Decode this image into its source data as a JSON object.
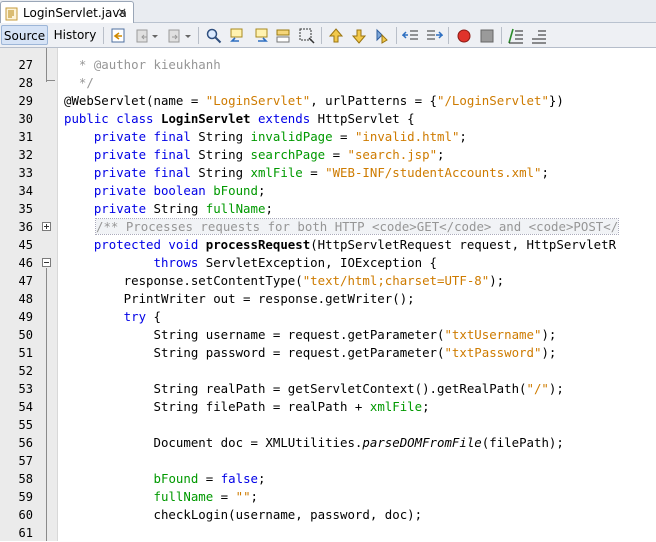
{
  "tab": {
    "title": "LoginServlet.java",
    "close": "×"
  },
  "toolbar": {
    "source_label": "Source",
    "history_label": "History"
  },
  "lines": [
    {
      "n": "27"
    },
    {
      "n": "28"
    },
    {
      "n": "29"
    },
    {
      "n": "30"
    },
    {
      "n": "31"
    },
    {
      "n": "32"
    },
    {
      "n": "33"
    },
    {
      "n": "34"
    },
    {
      "n": "35"
    },
    {
      "n": "36"
    },
    {
      "n": "45"
    },
    {
      "n": "46"
    },
    {
      "n": "47"
    },
    {
      "n": "48"
    },
    {
      "n": "49"
    },
    {
      "n": "50"
    },
    {
      "n": "51"
    },
    {
      "n": "52"
    },
    {
      "n": "53"
    },
    {
      "n": "54"
    },
    {
      "n": "55"
    },
    {
      "n": "56"
    },
    {
      "n": "57"
    },
    {
      "n": "58"
    },
    {
      "n": "59"
    },
    {
      "n": "60"
    },
    {
      "n": "61"
    }
  ],
  "code": {
    "l27": {
      "a": "  * @author kieukhanh"
    },
    "l28": {
      "a": "  */"
    },
    "l29": {
      "a": "@WebServlet(name = ",
      "b": "\"LoginServlet\"",
      "c": ", urlPatterns = {",
      "d": "\"/LoginServlet\"",
      "e": "})"
    },
    "l30": {
      "a": "public class",
      "b": " LoginServlet ",
      "c": "extends",
      "d": " HttpServlet {"
    },
    "l31": {
      "a": "    private final",
      "b": " String ",
      "c": "invalidPage",
      "d": " = ",
      "e": "\"invalid.html\"",
      "f": ";"
    },
    "l32": {
      "a": "    private final",
      "b": " String ",
      "c": "searchPage",
      "d": " = ",
      "e": "\"search.jsp\"",
      "f": ";"
    },
    "l33": {
      "a": "    private final",
      "b": " String ",
      "c": "xmlFile",
      "d": " = ",
      "e": "\"WEB-INF/studentAccounts.xml\"",
      "f": ";"
    },
    "l34": {
      "a": "    private boolean",
      "b": " ",
      "c": "bFound",
      "d": ";"
    },
    "l35": {
      "a": "    private",
      "b": " String ",
      "c": "fullName",
      "d": ";"
    },
    "l36": {
      "a": "/** Processes requests for both HTTP <code>GET</code> and <code>POST</"
    },
    "l45": {
      "a": "    protected void",
      "b": " processRequest",
      "c": "(HttpServletRequest request, HttpServletR"
    },
    "l46": {
      "a": "            throws",
      "b": " ServletException, IOException {"
    },
    "l47": {
      "a": "        response.setContentType(",
      "b": "\"text/html;charset=UTF-8\"",
      "c": ");"
    },
    "l48": {
      "a": "        PrintWriter out = response.getWriter();"
    },
    "l49": {
      "a": "        try",
      "b": " {"
    },
    "l50": {
      "a": "            String username = request.getParameter(",
      "b": "\"txtUsername\"",
      "c": ");"
    },
    "l51": {
      "a": "            String password = request.getParameter(",
      "b": "\"txtPassword\"",
      "c": ");"
    },
    "l53": {
      "a": "            String realPath = getServletContext().getRealPath(",
      "b": "\"/\"",
      "c": ");"
    },
    "l54": {
      "a": "            String filePath = realPath + ",
      "b": "xmlFile",
      "c": ";"
    },
    "l56": {
      "a": "            Document doc = XMLUtilities.",
      "b": "parseDOMFromFile",
      "c": "(filePath);"
    },
    "l58": {
      "a": "            ",
      "b": "bFound",
      "c": " = ",
      "d": "false",
      "e": ";"
    },
    "l59": {
      "a": "            ",
      "b": "fullName",
      "c": " = ",
      "d": "\"\"",
      "e": ";"
    },
    "l60": {
      "a": "            checkLogin(username, password, doc);"
    }
  },
  "icons": [
    "back-icon",
    "navigate-back-icon",
    "navigate-forward-icon",
    "find-icon",
    "find-previous-icon",
    "find-next-icon",
    "toggle-highlight-icon",
    "toggle-rect-selection-icon",
    "previous-bookmark-icon",
    "next-bookmark-icon",
    "toggle-bookmark-icon",
    "shift-left-icon",
    "shift-right-icon",
    "start-macro-icon",
    "stop-macro-icon",
    "comment-icon",
    "uncomment-icon"
  ]
}
